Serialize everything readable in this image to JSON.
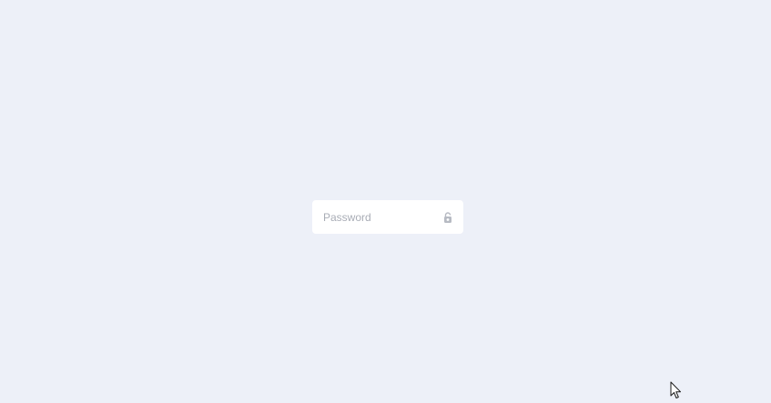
{
  "login": {
    "password_placeholder": "Password",
    "password_value": "",
    "lock_icon": "lock-icon"
  },
  "colors": {
    "background": "#edf0f8",
    "field_background": "#ffffff",
    "placeholder": "#a9adb6",
    "icon": "#b7bbc3"
  },
  "pointer": {
    "icon": "arrow-cursor-icon"
  }
}
